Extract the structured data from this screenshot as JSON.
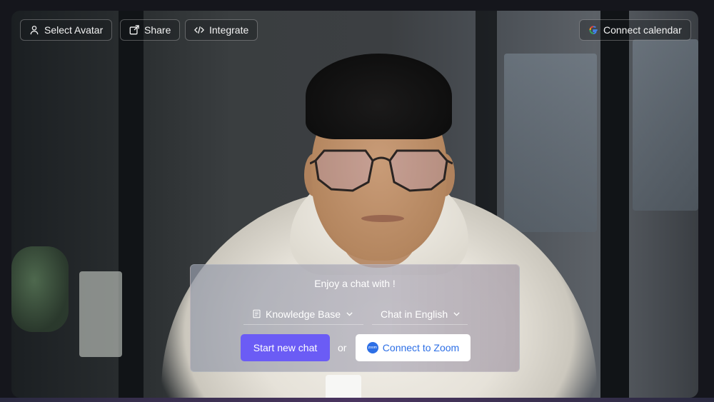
{
  "toolbar": {
    "select_avatar_label": "Select Avatar",
    "share_label": "Share",
    "integrate_label": "Integrate",
    "connect_calendar_label": "Connect calendar"
  },
  "chat_panel": {
    "title": "Enjoy a chat with !",
    "knowledge_base_label": "Knowledge Base",
    "language_label": "Chat in English",
    "start_chat_label": "Start new chat",
    "or_label": "or",
    "zoom_label": "Connect to Zoom",
    "zoom_logo_text": "zoom"
  },
  "colors": {
    "primary_button": "#6b5cf5",
    "zoom_blue": "#2d6fe6"
  },
  "icons": {
    "select_avatar": "user-icon",
    "share": "external-link-icon",
    "integrate": "code-icon",
    "calendar": "google-logo-icon",
    "knowledge_base": "book-icon",
    "dropdown": "chevron-down-icon"
  }
}
